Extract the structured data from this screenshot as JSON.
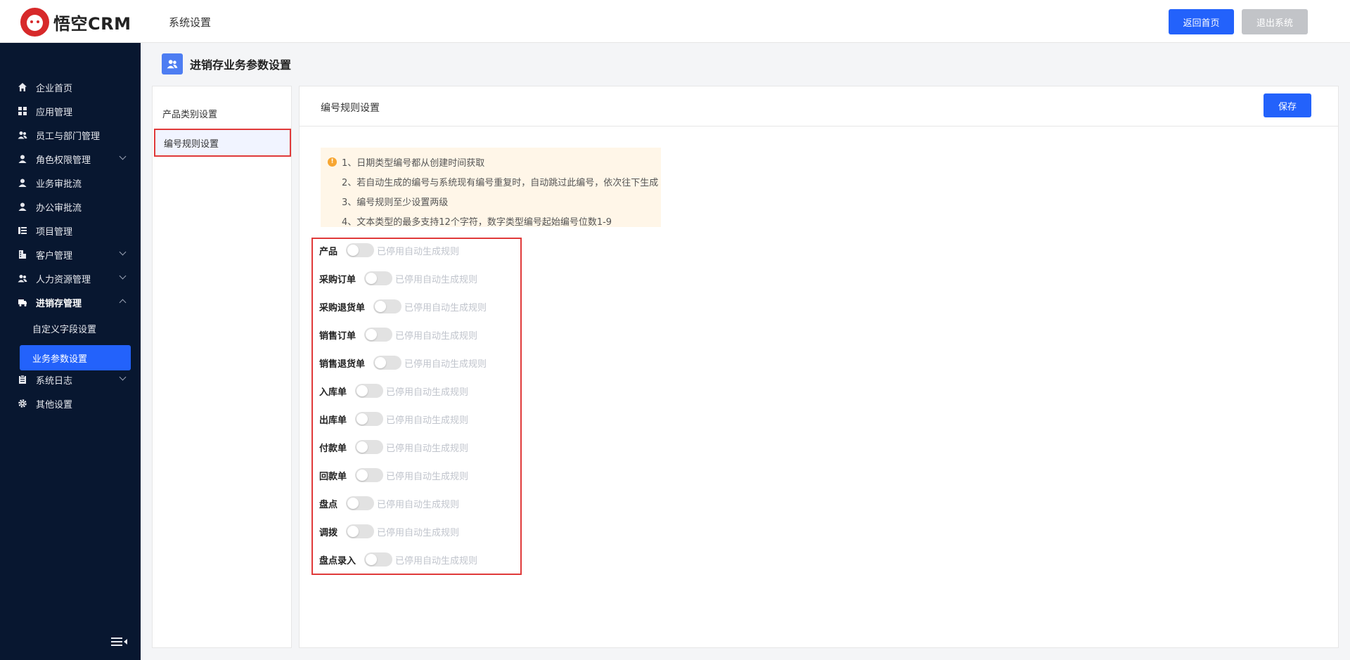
{
  "header": {
    "brand": "悟空CRM",
    "section_title": "系统设置",
    "home_button": "返回首页",
    "exit_button": "退出系统"
  },
  "sidebar": {
    "items": [
      {
        "label": "企业首页",
        "icon": "home-icon"
      },
      {
        "label": "应用管理",
        "icon": "grid-icon"
      },
      {
        "label": "员工与部门管理",
        "icon": "users-icon"
      },
      {
        "label": "角色权限管理",
        "icon": "user-icon",
        "expandable": true
      },
      {
        "label": "业务审批流",
        "icon": "user-icon"
      },
      {
        "label": "办公审批流",
        "icon": "user-icon"
      },
      {
        "label": "项目管理",
        "icon": "list-icon"
      },
      {
        "label": "客户管理",
        "icon": "building-icon",
        "expandable": true
      },
      {
        "label": "人力资源管理",
        "icon": "users-icon",
        "expandable": true
      },
      {
        "label": "进销存管理",
        "icon": "truck-icon",
        "expandable": true,
        "expanded": true
      },
      {
        "label": "系统日志",
        "icon": "clipboard-icon",
        "expandable": true
      },
      {
        "label": "其他设置",
        "icon": "gear-icon"
      }
    ],
    "sub_items": [
      {
        "label": "自定义字段设置",
        "active": false
      },
      {
        "label": "业务参数设置",
        "active": true
      }
    ]
  },
  "page": {
    "title": "进销存业务参数设置"
  },
  "left_menu": {
    "items": [
      {
        "label": "产品类别设置",
        "active": false
      },
      {
        "label": "编号规则设置",
        "active": true
      }
    ]
  },
  "main": {
    "title": "编号规则设置",
    "save_button": "保存",
    "notices": [
      "1、日期类型编号都从创建时间获取",
      "2、若自动生成的编号与系统现有编号重复时，自动跳过此编号，依次往下生成",
      "3、编号规则至少设置两级",
      "4、文本类型的最多支持12个字符，数字类型编号起始编号位数1-9"
    ],
    "rules": [
      {
        "label": "产品",
        "enabled": false,
        "status": "已停用自动生成规则"
      },
      {
        "label": "采购订单",
        "enabled": false,
        "status": "已停用自动生成规则"
      },
      {
        "label": "采购退货单",
        "enabled": false,
        "status": "已停用自动生成规则"
      },
      {
        "label": "销售订单",
        "enabled": false,
        "status": "已停用自动生成规则"
      },
      {
        "label": "销售退货单",
        "enabled": false,
        "status": "已停用自动生成规则"
      },
      {
        "label": "入库单",
        "enabled": false,
        "status": "已停用自动生成规则"
      },
      {
        "label": "出库单",
        "enabled": false,
        "status": "已停用自动生成规则"
      },
      {
        "label": "付款单",
        "enabled": false,
        "status": "已停用自动生成规则"
      },
      {
        "label": "回款单",
        "enabled": false,
        "status": "已停用自动生成规则"
      },
      {
        "label": "盘点",
        "enabled": false,
        "status": "已停用自动生成规则"
      },
      {
        "label": "调拨",
        "enabled": false,
        "status": "已停用自动生成规则"
      },
      {
        "label": "盘点录入",
        "enabled": false,
        "status": "已停用自动生成规则"
      }
    ]
  },
  "colors": {
    "accent": "#2362fb",
    "sidebar_bg": "#081730",
    "highlight_border": "#e03a3a",
    "notice_bg": "#fff6e8"
  }
}
